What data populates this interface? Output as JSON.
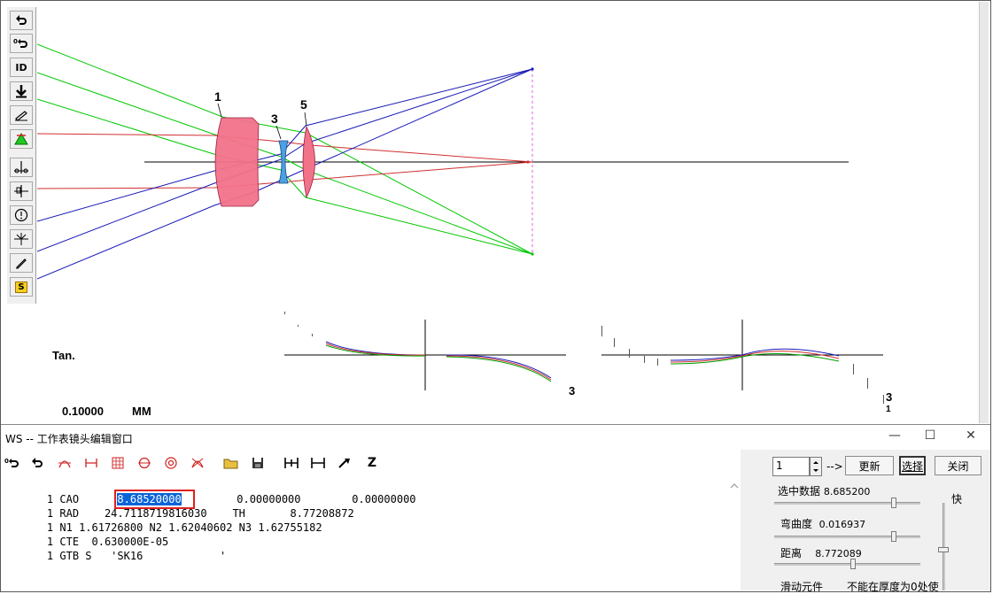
{
  "canvas": {
    "surface_labels": [
      "1",
      "3",
      "5"
    ],
    "aberration_label": "Tan.",
    "scale_value": "0.10000",
    "scale_unit": "MM",
    "plot1_end_label": "3",
    "plot2_end_label_a": "3",
    "plot2_end_label_b": "1"
  },
  "left_toolbar": {
    "icons": [
      "undo-icon",
      "undo-zero-icon",
      "id-icon",
      "download-arrow-icon",
      "edit-pencil-icon",
      "warning-triangle-icon",
      "lens-tool-a-icon",
      "lens-tool-b-icon",
      "circle-info-icon",
      "field-tool-icon",
      "pencil-icon",
      "s-badge-icon"
    ],
    "id_label": "ID",
    "s_label": "S"
  },
  "ws_window": {
    "title": "WS -- 工作表镜头编辑窗口",
    "minimize": "—",
    "maximize": "☐",
    "close": "✕",
    "toolbar_icons": [
      "undo-zero-icon",
      "undo-icon",
      "curve-icon",
      "thickness-icon",
      "grid-icon",
      "circle-cross-icon",
      "target-icon",
      "crossed-curve-icon",
      "folder-icon",
      "save-icon",
      "insert-after-icon",
      "insert-before-icon",
      "arrow-tool-icon",
      "z-icon"
    ],
    "toolbar_z_label": "Z",
    "editor_lines": [
      {
        "num": "1",
        "key": "CAO",
        "value": "8.68520000",
        "rest": "       0.00000000        0.00000000"
      },
      {
        "num": "1",
        "key": "RAD",
        "text": "    24.7118719816030    TH       8.77208872"
      },
      {
        "num": "1",
        "key": "N1",
        "text": "1.61726800 N2 1.62040602 N3 1.62755182"
      },
      {
        "num": "1",
        "key": "CTE",
        "text": "  0.630000E-05"
      },
      {
        "num": "1",
        "key": "GTB S",
        "text": "   'SK16            '"
      }
    ]
  },
  "right_panel": {
    "spinner_value": "1",
    "arrow_text": "-->",
    "update_label": "更新",
    "select_label": "选择",
    "close_label": "关闭",
    "selected_data_label": "选中数据",
    "selected_data_value": "8.685200",
    "curvature_label": "弯曲度",
    "curvature_value": "0.016937",
    "distance_label": "距离",
    "distance_value": "8.772089",
    "fast_label": "快",
    "slide_element_label": "滑动元件",
    "thickness_note": "不能在厚度为0处使",
    "slider_selected": 0.82,
    "slider_curvature": 0.82,
    "slider_distance": 0.54
  },
  "colors": {
    "lens_fill": "#f2728a",
    "lens_blue": "#4aa0e0",
    "ray_green": "#00c800",
    "ray_red": "#d03030",
    "ray_blue": "#1a1ab8",
    "highlight": "#0a64d8",
    "red_box": "#e02020"
  }
}
